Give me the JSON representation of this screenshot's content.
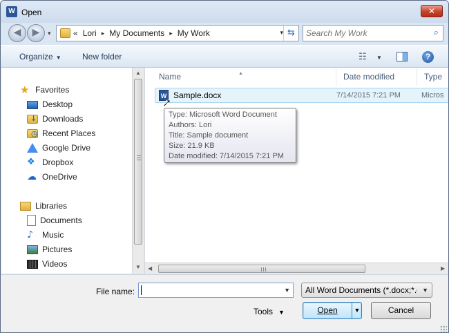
{
  "window": {
    "title": "Open",
    "app_icon": "W",
    "close_glyph": "✕"
  },
  "address_bar": {
    "overflow": "«",
    "crumbs": [
      "Lori",
      "My Documents",
      "My Work"
    ],
    "separator": "▸",
    "dropdown": "▾",
    "refresh": "⇆"
  },
  "nav_buttons": {
    "back": "◀",
    "forward": "▶",
    "dropdown": "▾"
  },
  "search": {
    "placeholder": "Search My Work",
    "icon": "⌕"
  },
  "toolbar": {
    "organize_label": "Organize",
    "organize_arrow": "▼",
    "new_folder_label": "New folder",
    "view_icon": "☷",
    "view_drop": "▼",
    "help_label": "?"
  },
  "nav_pane": {
    "favorites_header": "Favorites",
    "favorites": [
      "Desktop",
      "Downloads",
      "Recent Places",
      "Google Drive",
      "Dropbox",
      "OneDrive"
    ],
    "libraries_header": "Libraries",
    "libraries": [
      "Documents",
      "Music",
      "Pictures",
      "Videos"
    ],
    "icons": {
      "star": "★",
      "dropbox": "❖",
      "cloud": "☁",
      "music": "♪"
    }
  },
  "file_list": {
    "columns": [
      "Name",
      "Date modified",
      "Type"
    ],
    "sort_indicator": "▲",
    "rows": [
      {
        "icon": "W",
        "name": "Sample.docx",
        "date": "7/14/2015 7:21 PM",
        "type": "Micros"
      }
    ],
    "cursor": "➚"
  },
  "tooltip": {
    "lines": [
      "Type: Microsoft Word Document",
      "Authors: Lori",
      "Title: Sample document",
      "Size: 21.9 KB",
      "Date modified: 7/14/2015 7:21 PM"
    ]
  },
  "scrollbars": {
    "up": "▲",
    "down": "▼",
    "left": "◀",
    "right": "▶"
  },
  "bottom": {
    "file_name_label": "File name:",
    "file_name_value": "",
    "file_name_drop": "▼",
    "filter_value": "All Word Documents (*.docx;*.d",
    "filter_drop": "▼",
    "tools_label": "Tools",
    "tools_drop": "▼",
    "open_label": "Open",
    "open_split": "▼",
    "cancel_label": "Cancel"
  },
  "colors": {
    "frame": "#dbe6f3",
    "selection": "#e5f3fb",
    "accent": "#3c7fb1"
  }
}
